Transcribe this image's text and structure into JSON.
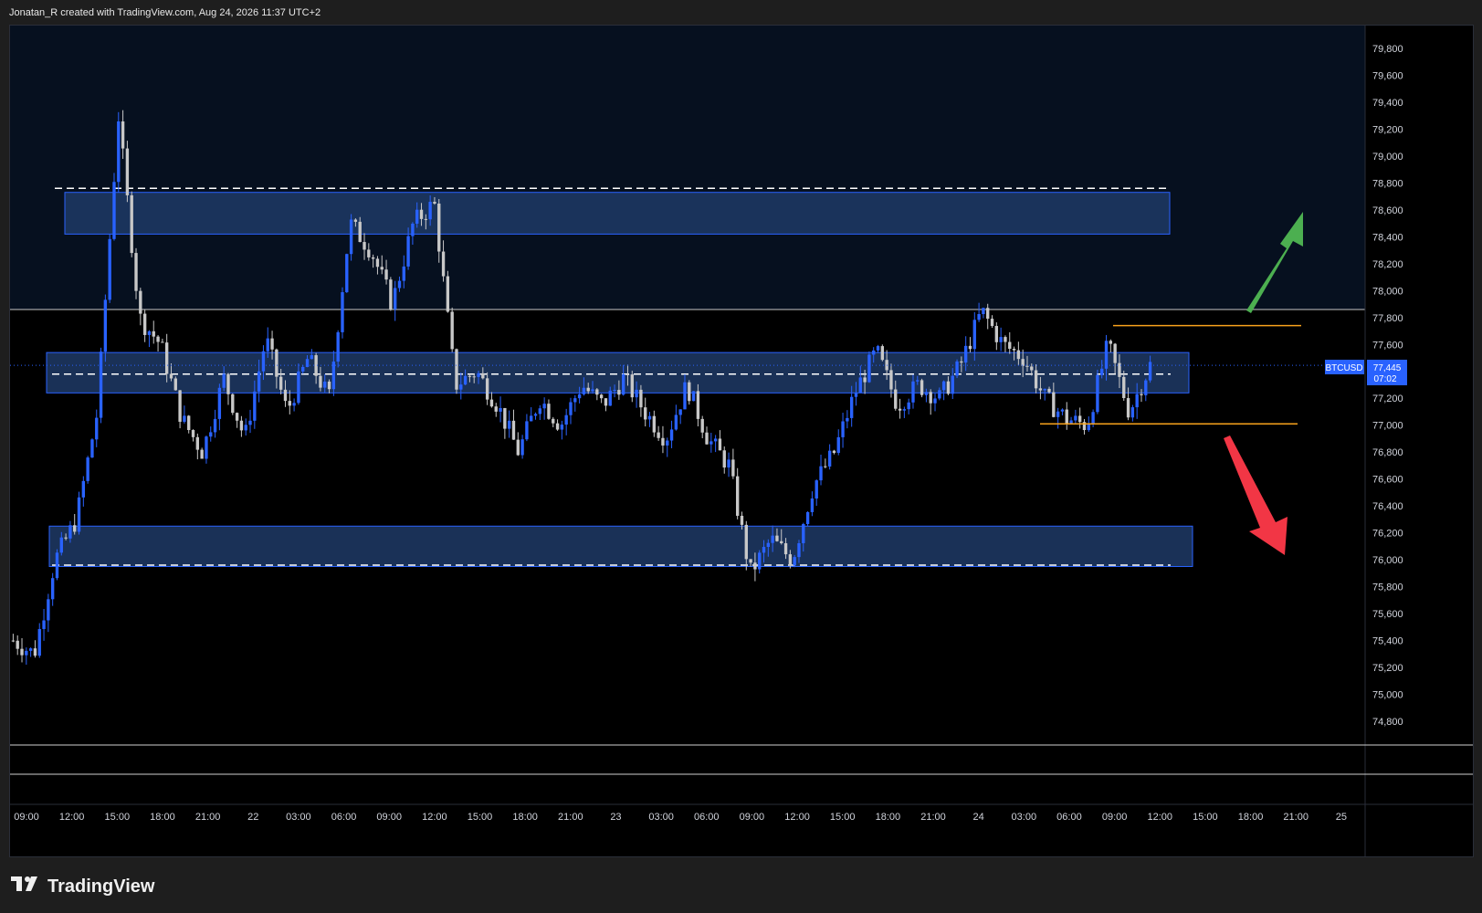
{
  "header": {
    "caption": "Jonatan_R created with TradingView.com, Aug 24, 2026 11:37 UTC+2"
  },
  "brand": {
    "logo": "TV",
    "name": "TradingView"
  },
  "colors": {
    "background": "#000000",
    "up_candle": "#2962ff",
    "down_candle": "#c8c8c8",
    "zone_fill": "#1e3a66",
    "zone_border": "#2962ff",
    "level_line": "#f7a21b",
    "arrow_up": "#4caf50",
    "arrow_down": "#f23645",
    "price_tag": "#2962ff"
  },
  "chart_data": {
    "type": "candlestick",
    "symbol": "BTCUSD",
    "last_price": "77,445",
    "countdown": "07:02",
    "ylim": [
      74600,
      79900
    ],
    "y_ticks": [
      "79,800",
      "79,600",
      "79,400",
      "79,200",
      "79,000",
      "78,800",
      "78,600",
      "78,400",
      "78,200",
      "78,000",
      "77,800",
      "77,600",
      "77,400",
      "77,200",
      "77,000",
      "76,800",
      "76,600",
      "76,400",
      "76,200",
      "76,000",
      "75,800",
      "75,600",
      "75,400",
      "75,200",
      "75,000",
      "74,800"
    ],
    "x_ticks": [
      "09:00",
      "12:00",
      "15:00",
      "18:00",
      "21:00",
      "22",
      "03:00",
      "06:00",
      "09:00",
      "12:00",
      "15:00",
      "18:00",
      "21:00",
      "23",
      "03:00",
      "06:00",
      "09:00",
      "12:00",
      "15:00",
      "18:00",
      "21:00",
      "24",
      "03:00",
      "06:00",
      "09:00",
      "12:00",
      "15:00",
      "18:00",
      "21:00",
      "25"
    ],
    "key_points": [
      {
        "t": 0,
        "p": 75400
      },
      {
        "t": 1,
        "p": 75300
      },
      {
        "t": 2,
        "p": 76000
      },
      {
        "t": 3,
        "p": 76300
      },
      {
        "t": 4,
        "p": 77100
      },
      {
        "t": 5,
        "p": 79300
      },
      {
        "t": 6,
        "p": 77800
      },
      {
        "t": 7,
        "p": 77600
      },
      {
        "t": 8,
        "p": 77050
      },
      {
        "t": 9,
        "p": 76800
      },
      {
        "t": 10,
        "p": 77350
      },
      {
        "t": 11,
        "p": 76900
      },
      {
        "t": 12,
        "p": 77650
      },
      {
        "t": 13,
        "p": 77100
      },
      {
        "t": 14,
        "p": 77500
      },
      {
        "t": 15,
        "p": 77200
      },
      {
        "t": 16,
        "p": 78500
      },
      {
        "t": 17,
        "p": 78300
      },
      {
        "t": 18,
        "p": 77900
      },
      {
        "t": 19,
        "p": 78500
      },
      {
        "t": 20,
        "p": 78650
      },
      {
        "t": 21,
        "p": 77300
      },
      {
        "t": 22,
        "p": 77400
      },
      {
        "t": 23,
        "p": 77150
      },
      {
        "t": 24,
        "p": 76800
      },
      {
        "t": 25,
        "p": 77200
      },
      {
        "t": 26,
        "p": 77000
      },
      {
        "t": 27,
        "p": 77300
      },
      {
        "t": 28,
        "p": 77150
      },
      {
        "t": 29,
        "p": 77350
      },
      {
        "t": 30,
        "p": 77100
      },
      {
        "t": 31,
        "p": 76900
      },
      {
        "t": 32,
        "p": 77300
      },
      {
        "t": 33,
        "p": 76900
      },
      {
        "t": 34,
        "p": 76700
      },
      {
        "t": 35,
        "p": 75900
      },
      {
        "t": 36,
        "p": 76150
      },
      {
        "t": 37,
        "p": 76000
      },
      {
        "t": 38,
        "p": 76550
      },
      {
        "t": 39,
        "p": 76800
      },
      {
        "t": 40,
        "p": 77250
      },
      {
        "t": 41,
        "p": 77550
      },
      {
        "t": 42,
        "p": 77150
      },
      {
        "t": 43,
        "p": 77300
      },
      {
        "t": 44,
        "p": 77200
      },
      {
        "t": 45,
        "p": 77450
      },
      {
        "t": 46,
        "p": 77850
      },
      {
        "t": 47,
        "p": 77600
      },
      {
        "t": 48,
        "p": 77500
      },
      {
        "t": 49,
        "p": 77200
      },
      {
        "t": 50,
        "p": 77050
      },
      {
        "t": 51,
        "p": 77000
      },
      {
        "t": 52,
        "p": 77600
      },
      {
        "t": 53,
        "p": 77100
      },
      {
        "t": 54,
        "p": 77445
      }
    ],
    "zones": [
      {
        "name": "upper-resistance-zone",
        "low": 78420,
        "high": 78730,
        "dashed_level": 78760
      },
      {
        "name": "middle-pivot-zone",
        "low": 77240,
        "high": 77540,
        "dashed_level": 77380
      },
      {
        "name": "lower-support-zone",
        "low": 75950,
        "high": 76250,
        "dashed_level": 75960
      }
    ],
    "levels": [
      {
        "name": "range-high",
        "price": 77740
      },
      {
        "name": "range-low",
        "price": 77010
      }
    ]
  }
}
